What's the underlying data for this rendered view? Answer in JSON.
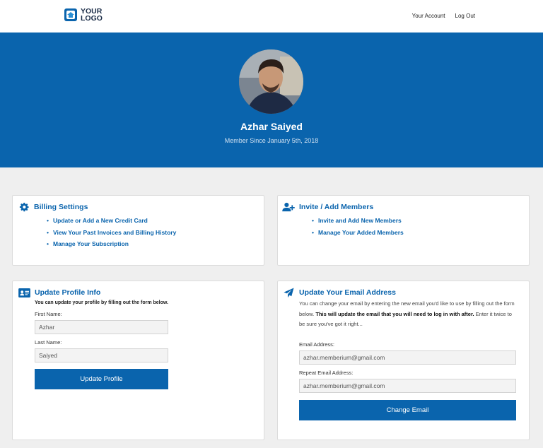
{
  "header": {
    "logo_line1": "YOUR",
    "logo_line2": "LOGO",
    "nav": {
      "account": "Your Account",
      "logout": "Log Out"
    }
  },
  "profile": {
    "name": "Azhar Saiyed",
    "member_since": "Member Since January 5th, 2018"
  },
  "billing": {
    "title": "Billing Settings",
    "icon": "gear-icon",
    "links": [
      "Update or Add a New Credit Card",
      "View Your Past Invoices and Billing History",
      "Manage Your Subscription"
    ]
  },
  "members": {
    "title": "Invite / Add Members",
    "icon": "add-user-icon",
    "links": [
      "Invite and Add New Members",
      "Manage Your Added Members"
    ]
  },
  "update_profile": {
    "title": "Update Profile Info",
    "icon": "id-card-icon",
    "subtitle": "You can update your profile by filling out the form below.",
    "first_name_label": "First Name:",
    "first_name_value": "Azhar",
    "last_name_label": "Last Name:",
    "last_name_value": "Saiyed",
    "button": "Update Profile"
  },
  "update_email": {
    "title": "Update Your Email Address",
    "icon": "paper-plane-icon",
    "desc_part1": "You can change your email by entering the new email you'd like to use by filling out the form below.",
    "desc_bold": "This will update the email that you will need to log in with after.",
    "desc_part2": "Enter it twice to be sure you've got it right...",
    "email_label": "Email Address:",
    "email_value": "azhar.memberium@gmail.com",
    "repeat_label": "Repeat Email Address:",
    "repeat_value": "azhar.memberium@gmail.com",
    "button": "Change Email"
  },
  "colors": {
    "primary": "#0a64ad",
    "background": "#efefef",
    "card": "#ffffff"
  }
}
